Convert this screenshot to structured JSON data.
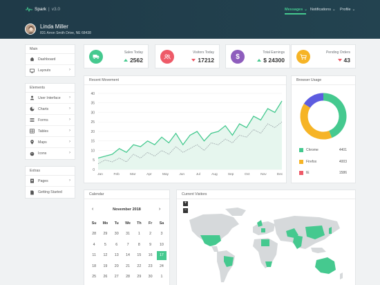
{
  "brand": {
    "name": "Spark",
    "version": "v3.0"
  },
  "nav": [
    {
      "label": "Messages",
      "active": true
    },
    {
      "label": "Notifications",
      "active": false
    },
    {
      "label": "Profile",
      "active": false
    }
  ],
  "user": {
    "name": "Linda Miller",
    "address": "831 Arron Smith Drive, NE 68438"
  },
  "sidebar": {
    "main": {
      "title": "Main",
      "items": [
        {
          "label": "Dashboard",
          "icon": "home-icon"
        },
        {
          "label": "Layouts",
          "icon": "monitor-icon"
        }
      ]
    },
    "elements": {
      "title": "Elements",
      "items": [
        {
          "label": "User Interface",
          "icon": "user-icon"
        },
        {
          "label": "Charts",
          "icon": "pie-chart-icon"
        },
        {
          "label": "Forms",
          "icon": "forms-icon"
        },
        {
          "label": "Tables",
          "icon": "table-icon"
        },
        {
          "label": "Maps",
          "icon": "map-marker-icon"
        },
        {
          "label": "Icons",
          "icon": "icons-icon"
        }
      ]
    },
    "extras": {
      "title": "Extras",
      "items": [
        {
          "label": "Pages",
          "icon": "pages-icon"
        },
        {
          "label": "Getting Started",
          "icon": "document-icon"
        }
      ]
    }
  },
  "stats": [
    {
      "label": "Sales Today",
      "value": "2562",
      "trend": "up",
      "color": "#45c98f",
      "icon": "truck-icon"
    },
    {
      "label": "Visitors Today",
      "value": "17212",
      "trend": "down",
      "color": "#ee5a68",
      "icon": "users-icon"
    },
    {
      "label": "Total Earnings",
      "value": "$ 24300",
      "trend": "up",
      "color": "#8e5dbd",
      "icon": "dollar-icon"
    },
    {
      "label": "Pending Orders",
      "value": "43",
      "trend": "down",
      "color": "#f6b426",
      "icon": "cart-icon"
    }
  ],
  "recent_movement": {
    "title": "Recent Movement"
  },
  "browser_usage": {
    "title": "Browser Usage"
  },
  "calendar": {
    "title": "Calendar",
    "month": "November 2018",
    "days": [
      "Su",
      "Mo",
      "Tu",
      "We",
      "Th",
      "Fr",
      "Sa"
    ],
    "weeks": [
      [
        "28",
        "29",
        "30",
        "31",
        "1",
        "2",
        "3"
      ],
      [
        "4",
        "5",
        "6",
        "7",
        "8",
        "9",
        "10"
      ],
      [
        "11",
        "12",
        "13",
        "14",
        "15",
        "16",
        "17"
      ],
      [
        "18",
        "19",
        "20",
        "21",
        "22",
        "23",
        "24"
      ],
      [
        "25",
        "26",
        "27",
        "28",
        "29",
        "30",
        "1"
      ]
    ],
    "selected": "17"
  },
  "visitors": {
    "title": "Current Visitors",
    "zoom_in": "+",
    "zoom_out": "−"
  },
  "chart_data": [
    {
      "type": "area",
      "categories": [
        "Jan",
        "Feb",
        "Mar",
        "Apr",
        "May",
        "Jun",
        "Jul",
        "Aug",
        "Sep",
        "Oct",
        "Nov",
        "Dec"
      ],
      "ylim": [
        0,
        40
      ],
      "yticks": [
        0,
        5,
        10,
        15,
        20,
        25,
        30,
        35,
        40
      ],
      "series": [
        {
          "color": "#45c98f",
          "values": [
            6,
            7,
            8,
            11,
            9,
            13,
            12,
            15,
            13,
            17,
            14,
            19,
            13,
            18,
            20,
            15,
            19,
            20,
            23,
            18,
            24,
            22,
            28,
            26,
            32,
            30,
            36
          ]
        },
        {
          "color": "#9aa3a8",
          "values": [
            3,
            5,
            4,
            6,
            4,
            8,
            6,
            9,
            7,
            10,
            8,
            12,
            9,
            11,
            13,
            10,
            14,
            13,
            16,
            14,
            18,
            17,
            21,
            19,
            24,
            22,
            25
          ]
        }
      ]
    },
    {
      "type": "pie",
      "categories": [
        "Chrome",
        "Firefox",
        "IE"
      ],
      "values": [
        4401,
        4003,
        1586
      ],
      "colors": [
        "#45c98f",
        "#f6b426",
        "#5d5ce0"
      ]
    }
  ]
}
